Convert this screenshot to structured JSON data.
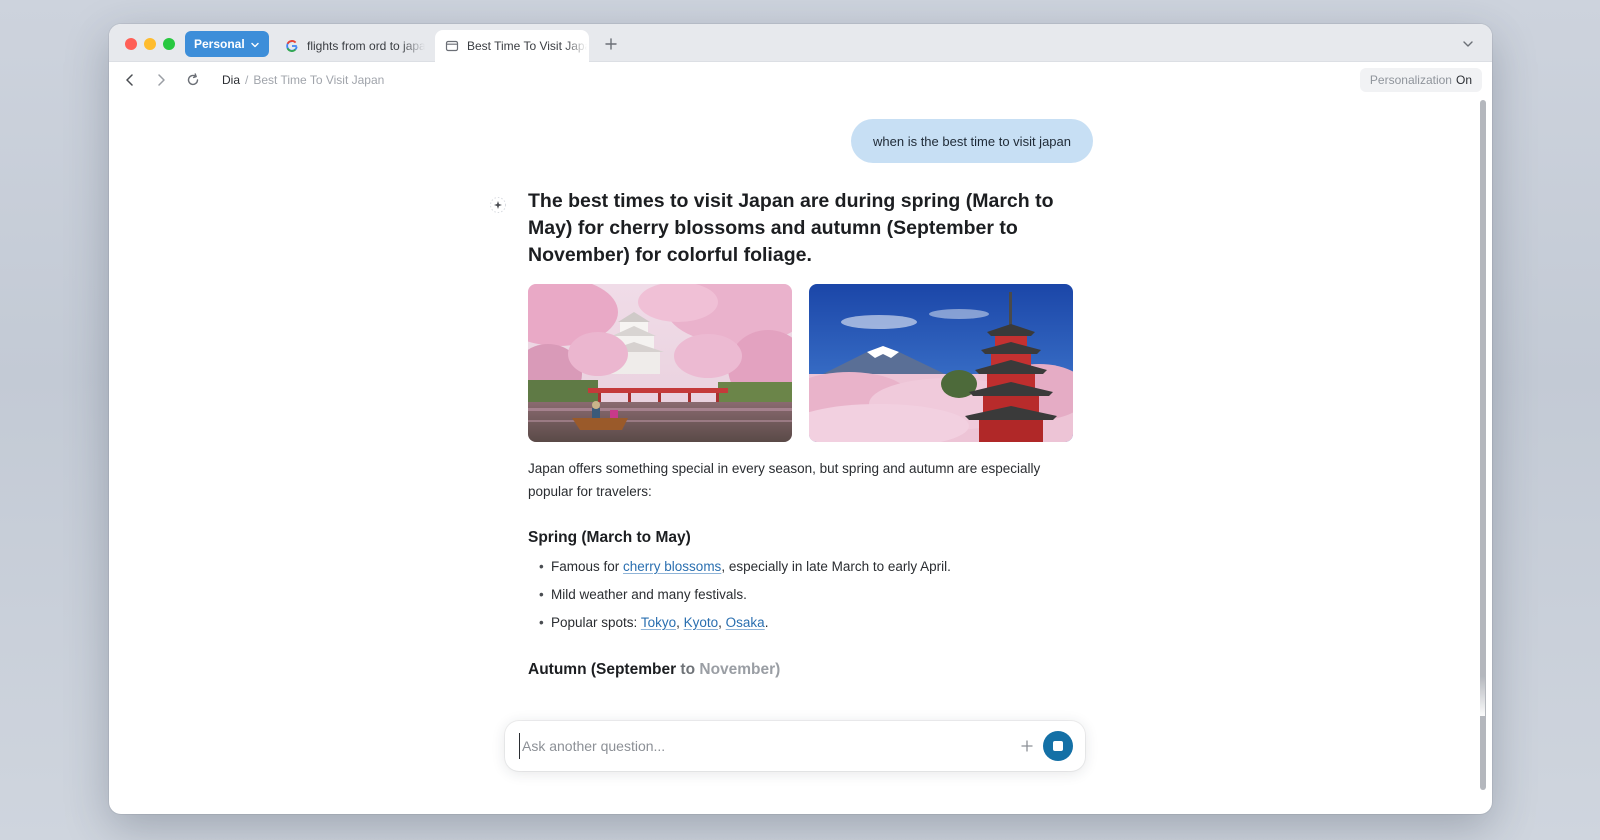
{
  "tabbar": {
    "profile_label": "Personal",
    "tabs": [
      {
        "label": "flights from ord to japan",
        "favicon": "google-icon"
      },
      {
        "label": "Best Time To Visit Japan",
        "favicon": "page-icon",
        "active": true
      }
    ],
    "new_tab_icon": "plus-icon",
    "tabs_menu_icon": "chevron-down-icon"
  },
  "toolbar": {
    "breadcrumb": {
      "root": "Dia",
      "separator": "/",
      "current": "Best Time To Visit Japan"
    },
    "personalization": {
      "label": "Personalization",
      "state": "On"
    }
  },
  "chat": {
    "user_message": "when is the best time to visit japan",
    "answer": {
      "heading": "The best times to visit Japan are during spring (March to May) for cherry blossoms and autumn (September to November) for colorful foliage.",
      "images": [
        {
          "subject": "cherry blossoms around a castle and bridge with a boat on a canal"
        },
        {
          "subject": "red pagoda with Mount Fuji and cherry blossoms"
        }
      ],
      "intro": "Japan offers something special in every season, but spring and autumn are especially popular for travelers:",
      "spring": {
        "heading": "Spring (March to May)",
        "bullets": {
          "b1": {
            "before": "Famous for ",
            "link": "cherry blossoms",
            "after": ", especially in late March to early April."
          },
          "b2": {
            "text": "Mild weather and many festivals."
          },
          "b3": {
            "before": "Popular spots: ",
            "links": [
              "Tokyo",
              "Kyoto",
              "Osaka"
            ],
            "comma": ", ",
            "end": "."
          }
        }
      },
      "autumn": {
        "part1": "Autumn (September",
        "part2": " to ",
        "part3": "November)"
      }
    }
  },
  "ask_bar": {
    "placeholder": "Ask another question...",
    "add_icon": "plus-icon",
    "stop_icon": "stop-icon"
  },
  "colors": {
    "accent": "#3d8ed9",
    "user_bubble": "#c7dff4",
    "link": "#2a6fb0",
    "stop_button": "#1470a6"
  }
}
